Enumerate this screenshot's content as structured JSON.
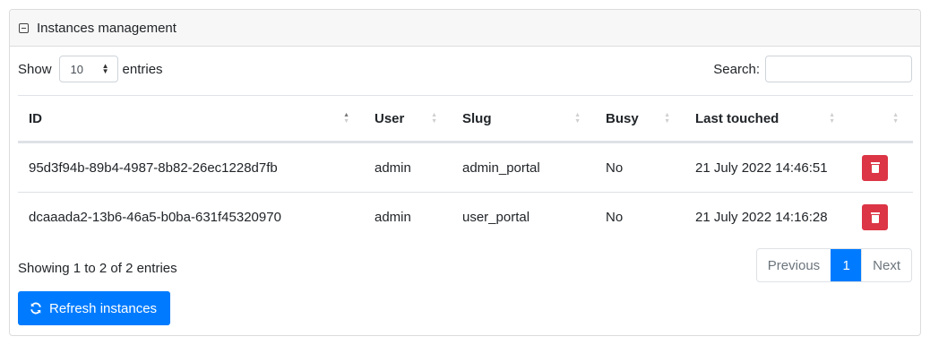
{
  "panel": {
    "title": "Instances management"
  },
  "length": {
    "show_label": "Show",
    "selected": "10",
    "entries_label": "entries"
  },
  "search": {
    "label": "Search:",
    "value": "",
    "placeholder": ""
  },
  "table": {
    "columns": [
      "ID",
      "User",
      "Slug",
      "Busy",
      "Last touched"
    ],
    "rows": [
      [
        "95d3f94b-89b4-4987-8b82-26ec1228d7fb",
        "admin",
        "admin_portal",
        "No",
        "21 July 2022 14:46:51"
      ],
      [
        "dcaaada2-13b6-46a5-b0ba-631f45320970",
        "admin",
        "user_portal",
        "No",
        "21 July 2022 14:16:28"
      ]
    ]
  },
  "info": "Showing 1 to 2 of 2 entries",
  "pagination": {
    "previous": "Previous",
    "current": "1",
    "next": "Next"
  },
  "refresh_button": {
    "label": "Refresh instances",
    "icon": "refresh-icon"
  },
  "colors": {
    "primary": "#007bff",
    "danger": "#dc3545"
  }
}
